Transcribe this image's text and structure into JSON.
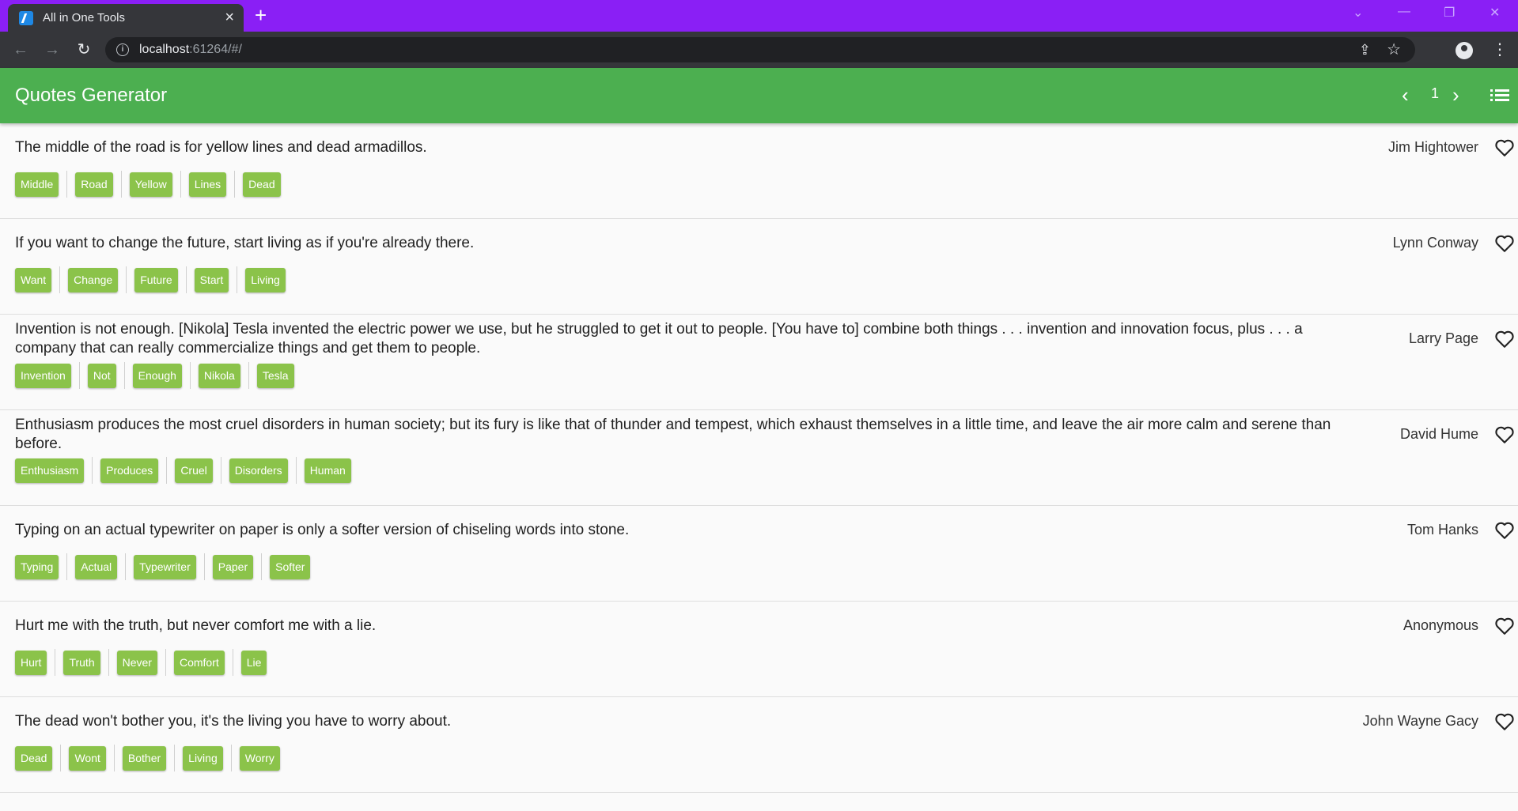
{
  "browser": {
    "tab_title": "All in One Tools",
    "url_host": "localhost",
    "url_rest": ":61264/#/"
  },
  "appbar": {
    "title": "Quotes Generator",
    "page_number": "1"
  },
  "quotes": [
    {
      "text": "The middle of the road is for yellow lines and dead armadillos.",
      "author": "Jim Hightower",
      "tags": [
        "Middle",
        "Road",
        "Yellow",
        "Lines",
        "Dead"
      ]
    },
    {
      "text": "If you want to change the future, start living as if you're already there.",
      "author": "Lynn Conway",
      "tags": [
        "Want",
        "Change",
        "Future",
        "Start",
        "Living"
      ]
    },
    {
      "text": "Invention is not enough. [Nikola] Tesla invented the electric power we use, but he struggled to get it out to people. [You have to] combine both things . . . invention and innovation focus, plus . . . a company that can really commercialize things and get them to people.",
      "author": "Larry Page",
      "tags": [
        "Invention",
        "Not",
        "Enough",
        "Nikola",
        "Tesla"
      ]
    },
    {
      "text": "Enthusiasm produces the most cruel disorders in human society; but its fury is like that of thunder and tempest, which exhaust themselves in a little time, and leave the air more calm and serene than before.",
      "author": "David Hume",
      "tags": [
        "Enthusiasm",
        "Produces",
        "Cruel",
        "Disorders",
        "Human"
      ]
    },
    {
      "text": "Typing on an actual typewriter on paper is only a softer version of chiseling words into stone.",
      "author": "Tom Hanks",
      "tags": [
        "Typing",
        "Actual",
        "Typewriter",
        "Paper",
        "Softer"
      ]
    },
    {
      "text": "Hurt me with the truth, but never comfort me with a lie.",
      "author": "Anonymous",
      "tags": [
        "Hurt",
        "Truth",
        "Never",
        "Comfort",
        "Lie"
      ]
    },
    {
      "text": "The dead won't bother you, it's the living you have to worry about.",
      "author": "John Wayne Gacy",
      "tags": [
        "Dead",
        "Wont",
        "Bother",
        "Living",
        "Worry"
      ]
    }
  ]
}
